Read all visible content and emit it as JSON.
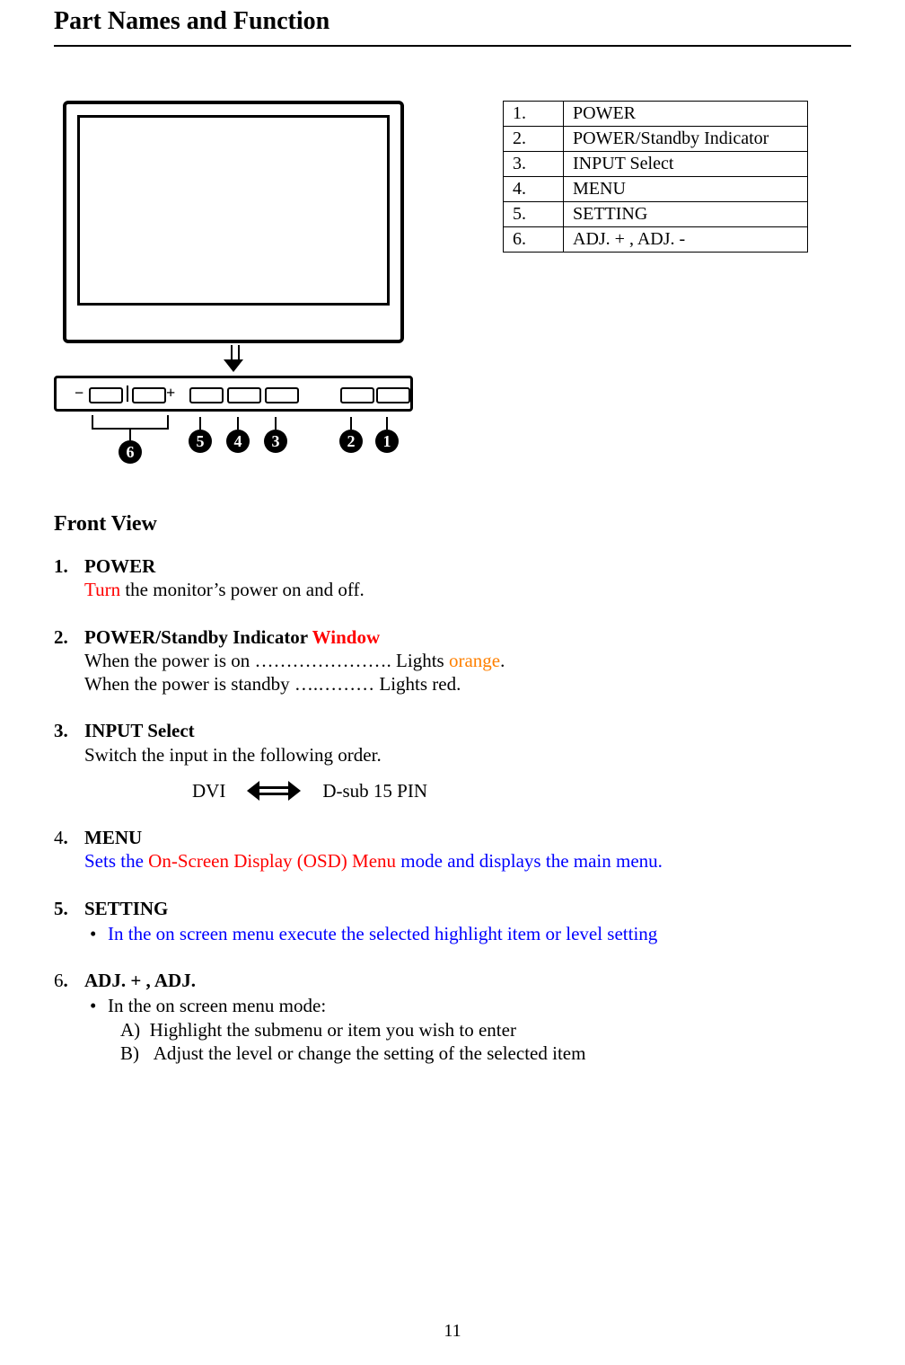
{
  "pageTitle": "Part Names and Function",
  "figure": {
    "callouts": {
      "c6": "6",
      "c5": "5",
      "c4": "4",
      "c3": "3",
      "c2": "2",
      "c1": "1"
    },
    "panelLabels": {
      "minus": "−",
      "plus": "+"
    }
  },
  "partsTable": [
    {
      "num": "1.",
      "label": "POWER"
    },
    {
      "num": "2.",
      "label": "POWER/Standby Indicator"
    },
    {
      "num": "3.",
      "label": "INPUT Select"
    },
    {
      "num": "4.",
      "label": "MENU"
    },
    {
      "num": "5.",
      "label": "SETTING"
    },
    {
      "num": "6.",
      "label": "ADJ. + , ADJ. -"
    }
  ],
  "frontView": {
    "heading": "Front View",
    "items": {
      "i1": {
        "num": "1.",
        "title": "POWER",
        "line1_red": "Turn",
        "line1_rest": " the monitor’s power on and off."
      },
      "i2": {
        "num": "2.",
        "title_pre": "POWER/Standby Indicator ",
        "title_red": "Window",
        "line1_pre": "When the power is on …………………. Lights ",
        "line1_orange": "orange",
        "line1_post": ".",
        "line2": "When the power is standby    ….……… Lights red."
      },
      "i3": {
        "num": "3.",
        "title": "INPUT Select",
        "line1": "Switch the input in the following order.",
        "swap_left": "DVI",
        "swap_right": "D-sub 15 PIN"
      },
      "i4": {
        "num_plain": "4",
        "num_bold": ".",
        "title": "MENU",
        "blue_pre": "Sets the ",
        "red_mid": "On-Screen Display (OSD) Menu",
        "blue_post": " mode and displays the main menu."
      },
      "i5": {
        "num": "5.",
        "title": "SETTING",
        "bullet_blue": "In the on screen menu execute the selected highlight item or level setting"
      },
      "i6": {
        "num_plain": "6",
        "num_bold": ".",
        "title": "ADJ. + , ADJ.",
        "bullet": "In the on screen menu mode:",
        "subA_label": "A)",
        "subA_text": "Highlight the submenu or item you wish to enter",
        "subB_label": "B)",
        "subB_text": "Adjust the level or change the setting of the selected item"
      }
    }
  },
  "pageNumber": "11"
}
